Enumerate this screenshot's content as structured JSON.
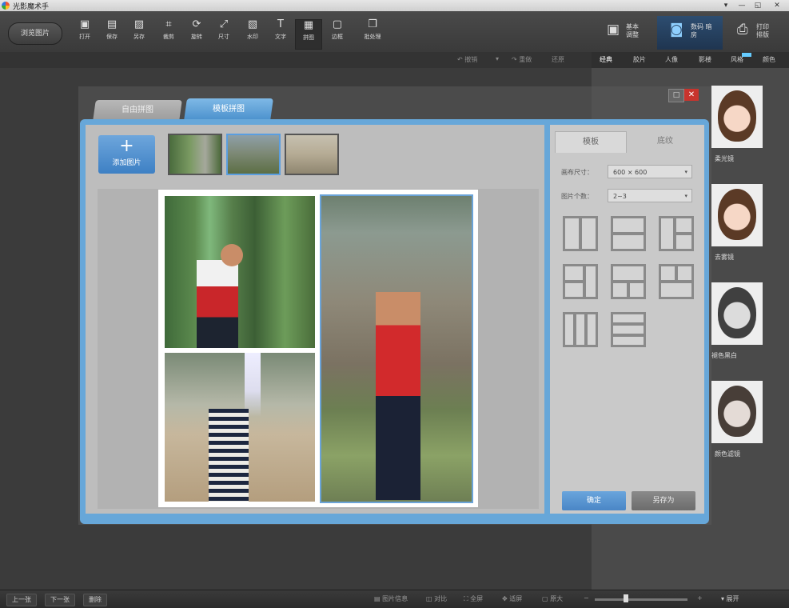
{
  "app": {
    "title": "光影魔术手"
  },
  "window_controls": {
    "menu": "▾",
    "minimize": "—",
    "restore": "◱",
    "close": "✕"
  },
  "toolbar": {
    "open_button": "浏览图片",
    "tools": [
      {
        "icon": "open-icon",
        "glyph": "▣",
        "label": "打开"
      },
      {
        "icon": "save-icon",
        "glyph": "▤",
        "label": "保存"
      },
      {
        "icon": "save-as-icon",
        "glyph": "▨",
        "label": "另存"
      },
      {
        "icon": "crop-icon",
        "glyph": "⌗",
        "label": "裁剪"
      },
      {
        "icon": "rotate-icon",
        "glyph": "⟳",
        "label": "旋转"
      },
      {
        "icon": "resize-icon",
        "glyph": "⤢",
        "label": "尺寸"
      },
      {
        "icon": "watermark-icon",
        "glyph": "▧",
        "label": "水印"
      },
      {
        "icon": "text-icon",
        "glyph": "T",
        "label": "文字"
      },
      {
        "icon": "collage-icon",
        "glyph": "▦",
        "label": "拼图"
      },
      {
        "icon": "border-icon",
        "glyph": "▢",
        "label": "边框"
      },
      {
        "icon": "batch-icon",
        "glyph": "❐",
        "label": "批处理"
      }
    ],
    "basic_adjust": "基本\n调整",
    "digital_darkroom": "数码\n暗房",
    "print_collage": "打印\n排版"
  },
  "subbar": {
    "undo": "↶ 撤销",
    "redo": "↷ 重做",
    "restore": "还原"
  },
  "right_tabs": [
    "经典",
    "胶片",
    "人像",
    "影楼",
    "风格",
    "颜色"
  ],
  "effects": [
    {
      "label": "柔光镜"
    },
    {
      "label": "去雾镜"
    },
    {
      "label": "褪色黑白"
    },
    {
      "label": "颜色滤镜"
    }
  ],
  "dialog": {
    "tab_free": "自由拼图",
    "tab_template": "模板拼图",
    "add_picture": "添加图片",
    "add_plus": "+",
    "max_button": "□",
    "close_button": "✕"
  },
  "settings": {
    "tab_template": "模板",
    "tab_texture": "底纹",
    "canvas_size_label": "画布尺寸：",
    "canvas_size_value": "600 × 600",
    "photo_count_label": "图片个数：",
    "photo_count_value": "2~3",
    "ok": "确定",
    "save_as": "另存为"
  },
  "bottom": {
    "prev": "上一张",
    "next": "下一张",
    "delete": "删除",
    "info": "▤ 图片信息",
    "compare": "◫ 对比",
    "fullscreen": "⛶ 全屏",
    "fit": "✥ 适屏",
    "actual": "▢ 原大",
    "expand": "▾ 展开"
  }
}
